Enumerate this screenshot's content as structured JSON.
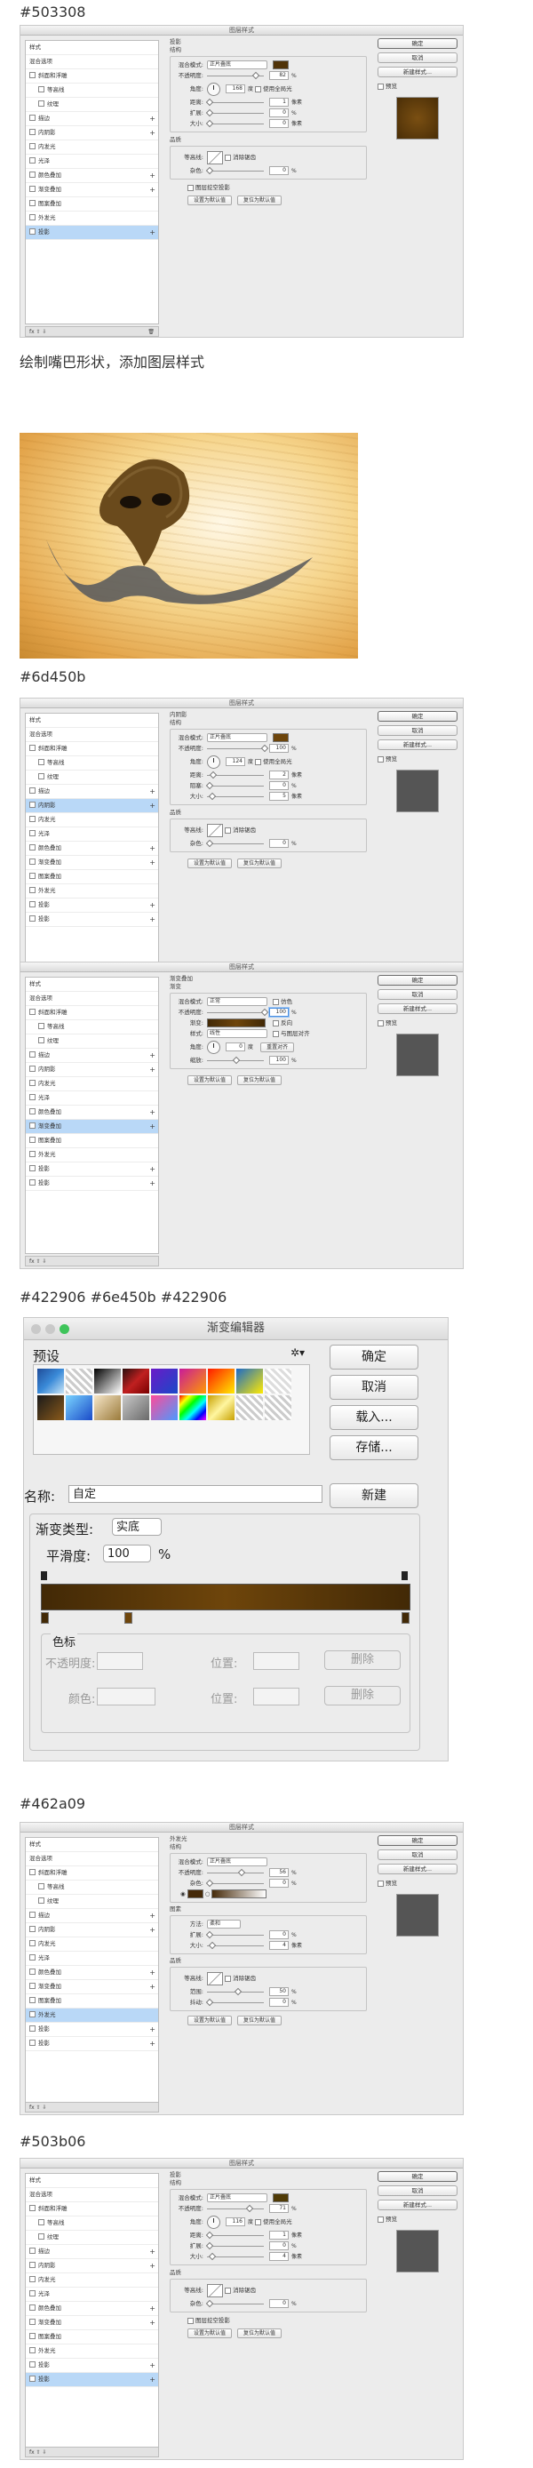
{
  "captions": {
    "c1": "#503308",
    "c2": "绘制嘴巴形状，添加图层样式",
    "c3": "#6d450b",
    "c4": "#422906  #6e450b  #422906",
    "c5": "#462a09",
    "c6": "#503b06"
  },
  "colors": {
    "c1": "#503308",
    "c3": "#6d450b",
    "c5": "#462a09",
    "c6": "#503b06",
    "preview_gray": "#555555"
  },
  "layer_style": {
    "title": "图层样式",
    "list_header": "样式",
    "blend_item": "混合选项",
    "items": [
      "斜面和浮雕",
      "等高线",
      "纹理",
      "描边",
      "内阴影",
      "内发光",
      "光泽",
      "颜色叠加",
      "渐变叠加",
      "图案叠加",
      "外发光",
      "投影",
      "投影"
    ],
    "fx": "fx",
    "buttons": {
      "ok": "确定",
      "cancel": "取消",
      "new_style": "新建样式...",
      "preview": "预览"
    },
    "make_default": "设置为默认值",
    "reset_default": "复位为默认值",
    "blend_mode_label": "混合模式:",
    "opacity_label": "不透明度:",
    "angle_label": "角度:",
    "global_light": "使用全局光",
    "distance_label": "距离:",
    "spread_label": "扩展:",
    "choke_label": "阻塞:",
    "size_label": "大小:",
    "quality": "品质",
    "contour_label": "等高线:",
    "antialias": "消除锯齿",
    "noise_label": "杂色:",
    "knockout": "图层挖空投影",
    "unit_px": "像素",
    "unit_pct": "%",
    "unit_deg": "度"
  },
  "panel1": {
    "section": "投影",
    "sub": "结构",
    "blend_mode": "正片叠底",
    "opacity": "82",
    "angle": "168",
    "distance": "1",
    "spread": "0",
    "size": "0",
    "noise": "0",
    "selected": 11
  },
  "panel2": {
    "section": "内阴影",
    "sub": "结构",
    "blend_mode": "正片叠底",
    "opacity": "100",
    "angle": "124",
    "distance": "2",
    "choke": "0",
    "size": "5",
    "noise": "0",
    "selected": 4
  },
  "panel3": {
    "section": "渐变叠加",
    "sub": "渐变",
    "blend_mode": "正常",
    "dither": "仿色",
    "opacity": "100",
    "gradient_label": "渐变:",
    "reverse": "反向",
    "style_label": "样式:",
    "style": "线性",
    "align": "与图层对齐",
    "angle": "0",
    "reset_align": "重置对齐",
    "scale_label": "缩放:",
    "scale": "100",
    "selected": 8
  },
  "gradient_editor": {
    "title": "渐变编辑器",
    "presets": "预设",
    "buttons": {
      "ok": "确定",
      "cancel": "取消",
      "load": "载入...",
      "save": "存储...",
      "new": "新建"
    },
    "name_label": "名称:",
    "name_value": "自定",
    "type_label": "渐变类型:",
    "type_value": "实底",
    "smooth_label": "平滑度:",
    "smooth_value": "100",
    "smooth_unit": "%",
    "stops": "色标",
    "stop_opacity": "不透明度:",
    "stop_location": "位置:",
    "delete": "删除",
    "stop_color": "颜色:"
  },
  "panel4": {
    "section": "外发光",
    "sub": "结构",
    "blend_mode": "正片叠底",
    "opacity": "56",
    "noise": "0",
    "elements": "图素",
    "technique_label": "方法:",
    "technique": "柔和",
    "spread": "0",
    "size": "4",
    "range_label": "范围:",
    "range": "50",
    "jitter_label": "抖动:",
    "jitter": "0",
    "selected": 10
  },
  "panel5": {
    "section": "投影",
    "sub": "结构",
    "blend_mode": "正片叠底",
    "opacity": "71",
    "angle": "116",
    "distance": "1",
    "spread": "0",
    "size": "4",
    "noise": "0",
    "selected": 12
  }
}
